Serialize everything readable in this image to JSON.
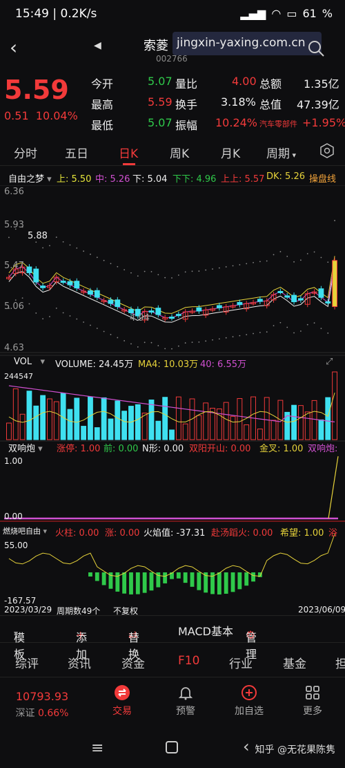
{
  "status_bar": {
    "time": "15:49",
    "net_speed": "0.2K/s",
    "battery": "61"
  },
  "header": {
    "stock_name": "索菱",
    "stock_code": "002766",
    "watermark": "jingxin-yaxing.com.cn"
  },
  "quote": {
    "price": "5.59",
    "change": "0.51",
    "change_pct": "10.04%",
    "rows": [
      {
        "l1": "今开",
        "v1": "5.07",
        "l2": "量比",
        "v2": "4.00",
        "l3": "总额",
        "v3": "1.35亿"
      },
      {
        "l1": "最高",
        "v1": "5.59",
        "l2": "换手",
        "v2": "3.18%",
        "l3": "总值",
        "v3": "47.39亿"
      },
      {
        "l1": "最低",
        "v1": "5.07",
        "l2": "振幅",
        "v2": "10.24%",
        "l3": "汽车零部件",
        "v3": "+1.95%"
      }
    ]
  },
  "tabs": [
    "分时",
    "五日",
    "日K",
    "周K",
    "月K",
    "周期"
  ],
  "indicator": {
    "name": "自由之梦",
    "items": [
      "上: 5.50",
      "中: 5.26",
      "下: 5.04",
      "下下: 4.96",
      "上上: 5.57",
      "DK: 5.26",
      "操盘线"
    ]
  },
  "kline": {
    "y_labels": [
      "6.36",
      "5.93",
      "5.47",
      "5.06",
      "4.63"
    ],
    "high_label": "5.88",
    "low_label": "4.94"
  },
  "volume_panel": {
    "name": "VOL",
    "volume": "VOLUME: 24.45万",
    "ma4": "MA4: 10.03万",
    "ma40": "40: 6.55万",
    "top": "244547"
  },
  "shx_panel": {
    "name": "双响炮",
    "items": [
      "涨停: 1.00",
      "前: 0.00",
      "N形: 0.00",
      "双阳开山: 0.00",
      "金叉: 1.00",
      "双响炮:"
    ],
    "top": "1.00",
    "bottom": "0.00"
  },
  "fire_panel": {
    "name": "燃烧吧自由",
    "items": [
      "火柱: 0.00",
      "涨: 0.00",
      "火焰值: -37.31",
      "赴汤蹈火: 0.00",
      "希望: 1.00",
      "浴"
    ],
    "top": "55.00",
    "bottom": "-167.57"
  },
  "footer_axis": {
    "start": "2023/03/29",
    "period": "周期数49个",
    "adjust": "不复权",
    "end": "2023/06/09"
  },
  "toolbar": {
    "template": "模板",
    "add": "添加",
    "replace": "替换",
    "macd": "MACD基本",
    "manage": "管理"
  },
  "subtabs": [
    "综评",
    "资讯",
    "资金",
    "F10",
    "行业",
    "基金",
    "担"
  ],
  "bottom_nav": {
    "index_value": "10793.93",
    "index_name": "深证",
    "index_pct": "0.66%",
    "trade": "交易",
    "alert": "预警",
    "watch": "加自选",
    "more": "更多"
  },
  "credit": "知乎 @无花果陈隽",
  "colors": {
    "up": "#f23a3a",
    "down": "#2fc94a",
    "cyan": "#3fe0f0",
    "yellow": "#e6d23a",
    "magenta": "#d050d0"
  }
}
